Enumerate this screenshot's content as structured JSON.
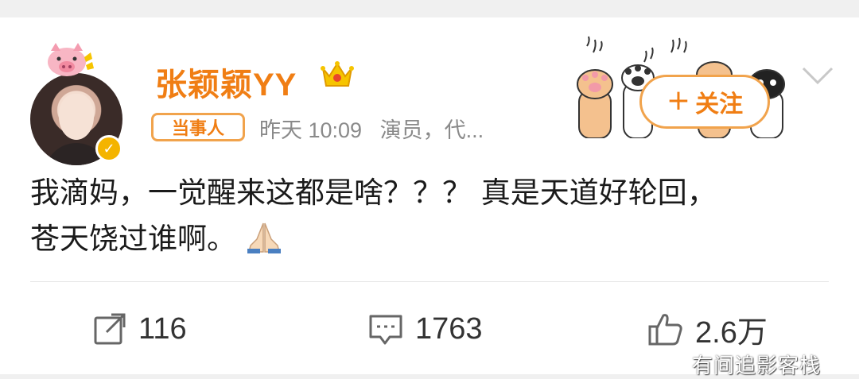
{
  "user": {
    "name": "张颖颖YY",
    "tag": "当事人",
    "time": "昨天 10:09",
    "bio_snippet": "演员，代..."
  },
  "follow_button": {
    "plus": "+",
    "label": "关注"
  },
  "post": {
    "line1": "我滴妈，一觉醒来这都是啥？？？ 真是天道好轮回，",
    "line2": "苍天饶过谁啊。"
  },
  "actions": {
    "repost_count": "116",
    "comment_count": "1763",
    "like_count": "2.6万"
  },
  "watermark": "有间追影客栈",
  "colors": {
    "accent_orange": "#f07e14",
    "tag_border": "#f1a34c",
    "meta_gray": "#8a8a8a",
    "verify_gold": "#f4b400"
  },
  "icons": {
    "verify": "verified-badge-icon",
    "crown": "crown-icon",
    "expand": "chevron-down-icon",
    "repost": "repost-icon",
    "comment": "comment-icon",
    "like": "thumbs-up-icon",
    "emoji": "pray-emoji"
  }
}
